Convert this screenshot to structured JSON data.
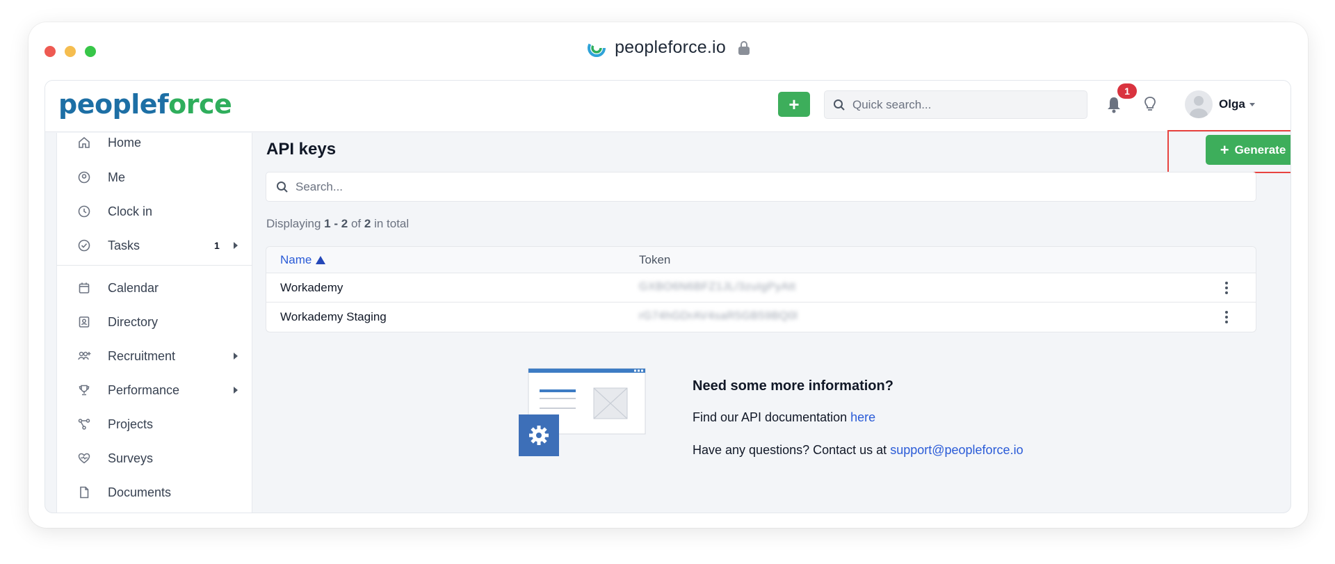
{
  "browser": {
    "url": "peopleforce.io",
    "colors": {
      "close": "#ee5a52",
      "minimize": "#f5bd4f",
      "maximize": "#37c648"
    }
  },
  "header": {
    "logo_part1": "peoplef",
    "logo_part2": "o",
    "logo_part3": "rce",
    "quick_add_label": "+",
    "search_placeholder": "Quick search...",
    "notification_count": "1",
    "user_name": "Olga",
    "colors": {
      "brand_blue": "#1d6fa5",
      "brand_green": "#2fae5c",
      "badge": "#d9333f"
    }
  },
  "sidebar": {
    "items": [
      {
        "label": "Home",
        "icon": "home-icon"
      },
      {
        "label": "Me",
        "icon": "user-circle-icon"
      },
      {
        "label": "Clock in",
        "icon": "clock-icon"
      },
      {
        "label": "Tasks",
        "icon": "check-circle-icon",
        "count": "1",
        "has_submenu": true
      },
      {
        "label": "Calendar",
        "icon": "calendar-icon"
      },
      {
        "label": "Directory",
        "icon": "contact-card-icon"
      },
      {
        "label": "Recruitment",
        "icon": "people-add-icon",
        "has_submenu": true
      },
      {
        "label": "Performance",
        "icon": "trophy-icon",
        "has_submenu": true
      },
      {
        "label": "Projects",
        "icon": "project-nodes-icon"
      },
      {
        "label": "Surveys",
        "icon": "heart-pulse-icon"
      },
      {
        "label": "Documents",
        "icon": "document-icon"
      }
    ]
  },
  "main": {
    "title": "API keys",
    "generate_label": "Generate",
    "search_placeholder": "Search...",
    "displaying": {
      "prefix": "Displaying",
      "range": "1 - 2",
      "of": "of",
      "total": "2",
      "suffix": "in total"
    },
    "table": {
      "columns": [
        "Name",
        "Token"
      ],
      "rows": [
        {
          "name": "Workademy",
          "token": "GXBO6N6BFZ1JL/3zuIgPyAtt"
        },
        {
          "name": "Workademy Staging",
          "token": "rG74hGDrAV4saR5GB59BQ0l"
        }
      ]
    },
    "info": {
      "title": "Need some more information?",
      "doc_text": "Find our API documentation",
      "doc_link": "here",
      "contact_text": "Have any questions? Contact us at",
      "contact_link": "support@peopleforce.io"
    },
    "colors": {
      "primary_green": "#3dae5b",
      "link_blue": "#2a5bd7",
      "highlight_red": "#e8433f"
    }
  }
}
